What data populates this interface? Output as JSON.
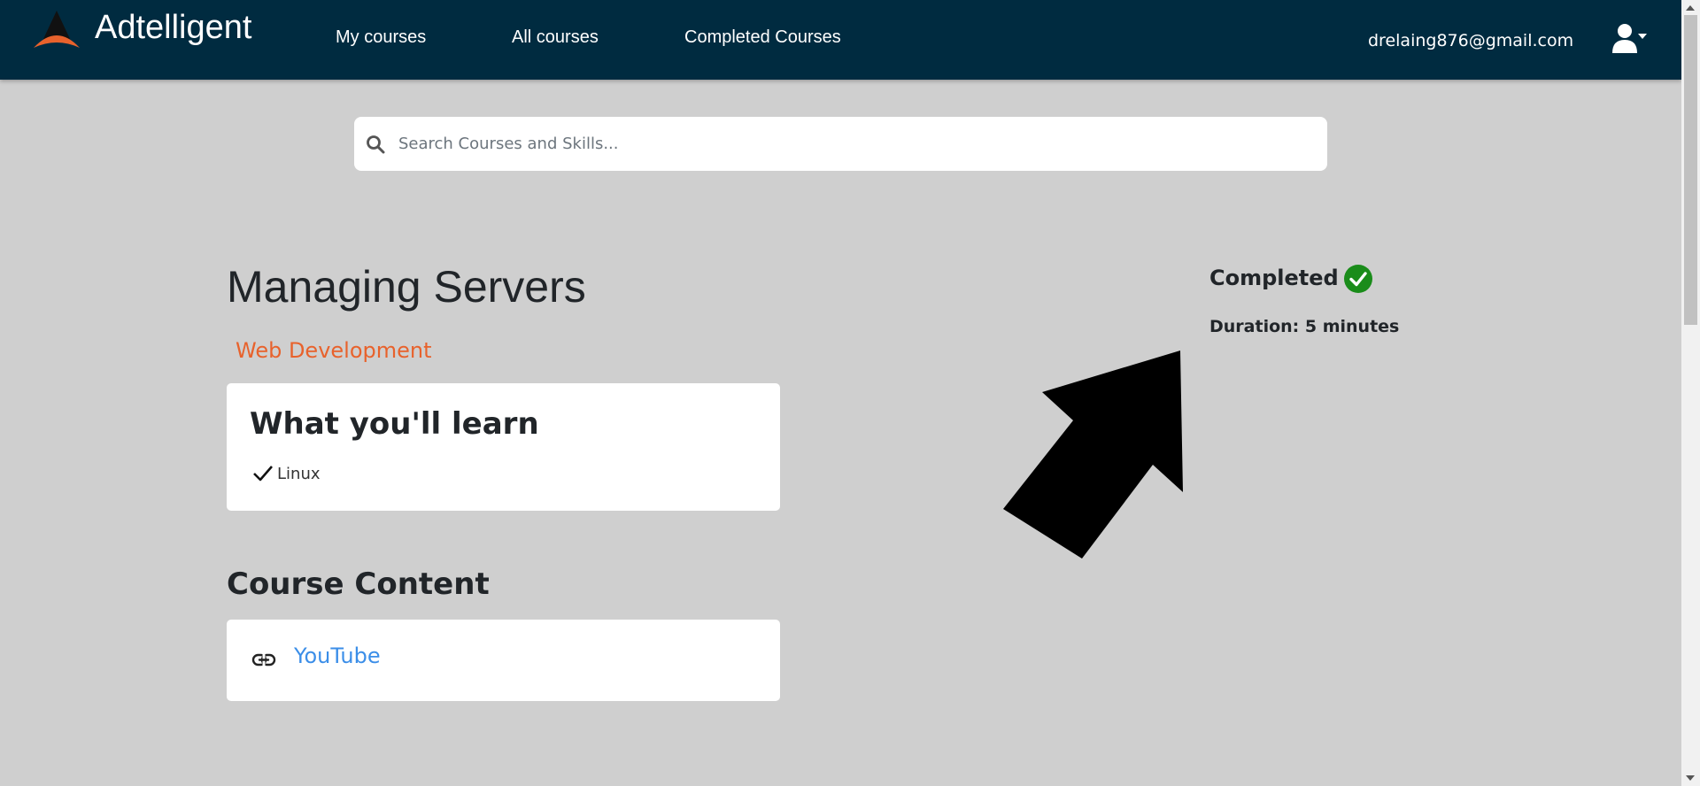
{
  "header": {
    "brand_name": "Adtelligent",
    "nav": [
      {
        "label": "My courses"
      },
      {
        "label": "All courses"
      },
      {
        "label": "Completed Courses"
      }
    ],
    "user_email": "drelaing876@gmail.com",
    "user_menu_icon": "user-dropdown-icon"
  },
  "search": {
    "placeholder": "Search Courses and Skills...",
    "value": "",
    "icon": "search-icon"
  },
  "course": {
    "title": "Managing Servers",
    "category": "Web Development",
    "learn": {
      "heading": "What you'll learn",
      "items": [
        "Linux"
      ]
    },
    "content": {
      "heading": "Course Content",
      "items": [
        {
          "label": "YouTube",
          "icon": "link-icon"
        }
      ]
    },
    "status": {
      "label": "Completed",
      "icon": "check-circle-icon",
      "color": "#1a8c1a"
    },
    "duration": "Duration: 5 minutes"
  },
  "colors": {
    "navbar": "#002b40",
    "accent": "#e8622c",
    "link": "#3b8ee8",
    "background": "#cfcfcf"
  }
}
